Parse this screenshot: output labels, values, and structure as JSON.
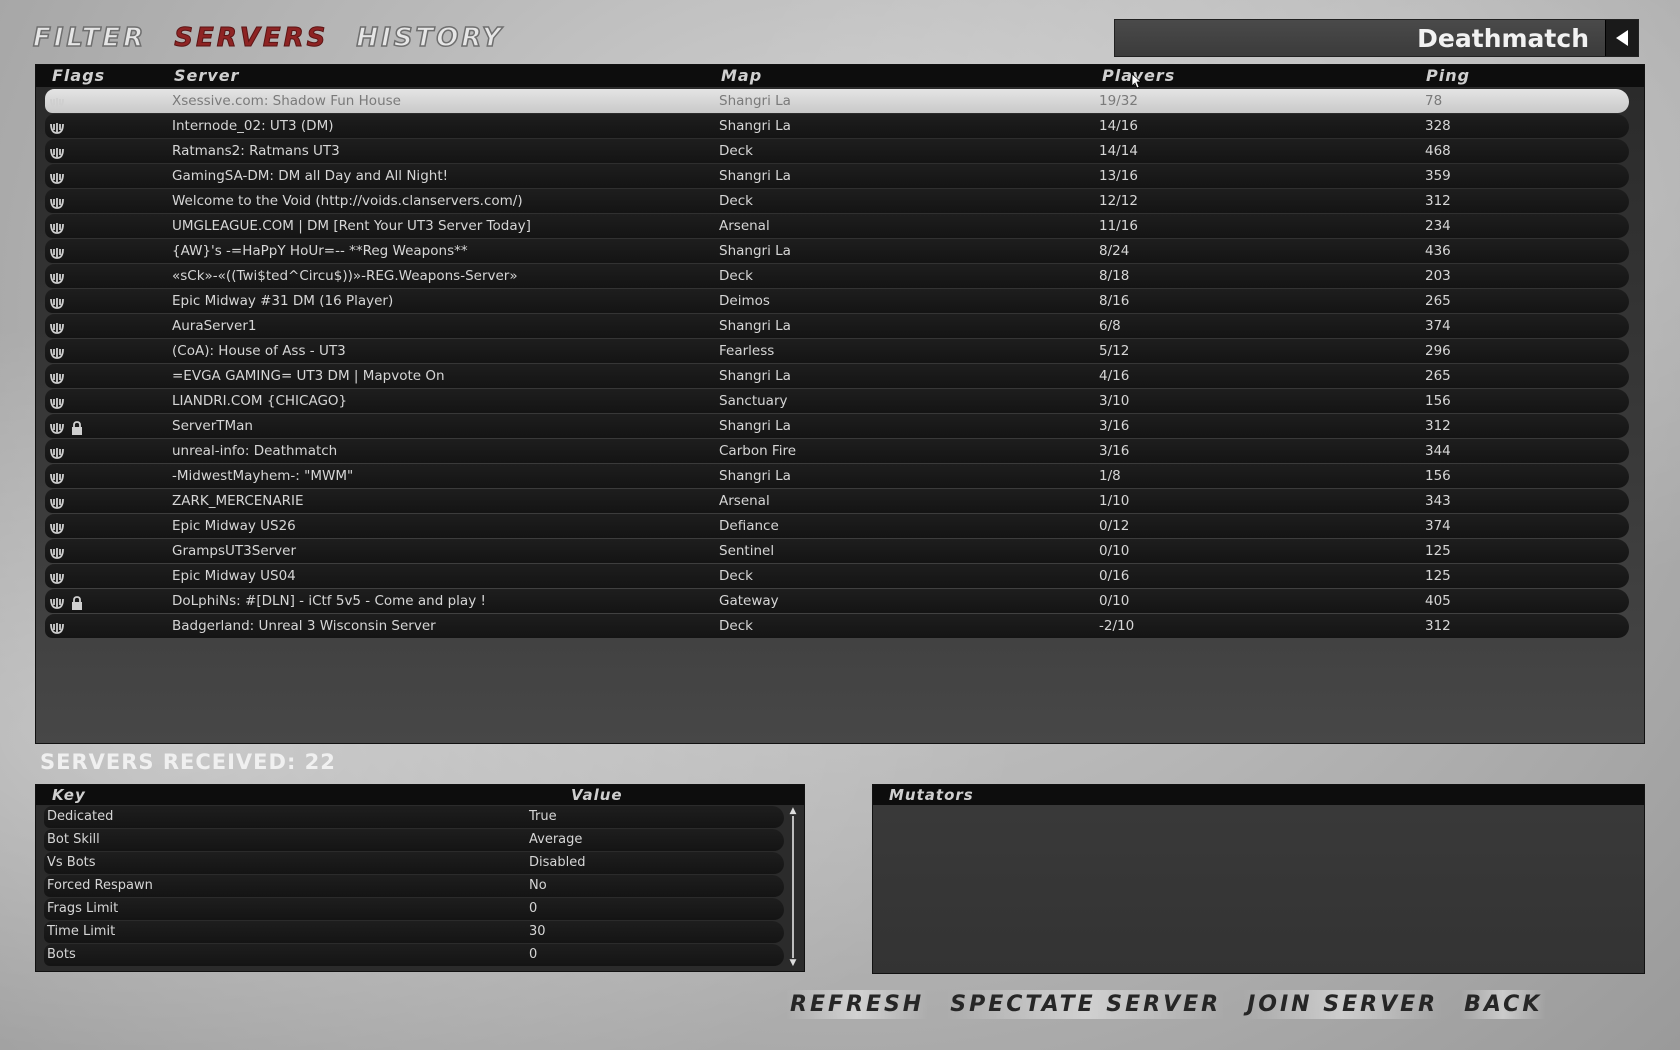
{
  "tabs": [
    {
      "label": "FILTER"
    },
    {
      "label": "SERVERS"
    },
    {
      "label": "HISTORY"
    }
  ],
  "gametype": {
    "label": "Deathmatch"
  },
  "columns": {
    "flags": "Flags",
    "server": "Server",
    "map": "Map",
    "players": "Players",
    "ping": "Ping"
  },
  "servers": [
    {
      "name": "Xsessive.com: Shadow Fun House",
      "map": "Shangri La",
      "players": "19/32",
      "ping": "78",
      "locked": false,
      "selected": true
    },
    {
      "name": "Internode_02: UT3 (DM)",
      "map": "Shangri La",
      "players": "14/16",
      "ping": "328",
      "locked": false
    },
    {
      "name": "Ratmans2: Ratmans UT3",
      "map": "Deck",
      "players": "14/14",
      "ping": "468",
      "locked": false
    },
    {
      "name": "GamingSA-DM: DM all Day and All Night!",
      "map": "Shangri La",
      "players": "13/16",
      "ping": "359",
      "locked": false
    },
    {
      "name": "Welcome to the Void (http://voids.clanservers.com/)",
      "map": "Deck",
      "players": "12/12",
      "ping": "312",
      "locked": false
    },
    {
      "name": "UMGLEAGUE.COM | DM [Rent Your UT3 Server Today]",
      "map": "Arsenal",
      "players": "11/16",
      "ping": "234",
      "locked": false
    },
    {
      "name": "{AW}'s -=HaPpY HoUr=-- **Reg Weapons**",
      "map": "Shangri La",
      "players": "8/24",
      "ping": "436",
      "locked": false
    },
    {
      "name": "«sCk»-«((Twi$ted^Circu$))»-REG.Weapons-Server»",
      "map": "Deck",
      "players": "8/18",
      "ping": "203",
      "locked": false
    },
    {
      "name": "Epic Midway #31 DM (16 Player)",
      "map": "Deimos",
      "players": "8/16",
      "ping": "265",
      "locked": false
    },
    {
      "name": "AuraServer1",
      "map": "Shangri La",
      "players": "6/8",
      "ping": "374",
      "locked": false
    },
    {
      "name": "(CoA): House of Ass - UT3",
      "map": "Fearless",
      "players": "5/12",
      "ping": "296",
      "locked": false
    },
    {
      "name": "=EVGA GAMING= UT3 DM | Mapvote On",
      "map": "Shangri La",
      "players": "4/16",
      "ping": "265",
      "locked": false
    },
    {
      "name": "LIANDRI.COM {CHICAGO}",
      "map": "Sanctuary",
      "players": "3/10",
      "ping": "156",
      "locked": false
    },
    {
      "name": "ServerTMan",
      "map": "Shangri La",
      "players": "3/16",
      "ping": "312",
      "locked": true
    },
    {
      "name": "unreal-info: Deathmatch",
      "map": "Carbon Fire",
      "players": "3/16",
      "ping": "344",
      "locked": false
    },
    {
      "name": "-MidwestMayhem-: \"MWM\"",
      "map": "Shangri La",
      "players": "1/8",
      "ping": "156",
      "locked": false
    },
    {
      "name": "ZARK_MERCENARIE",
      "map": "Arsenal",
      "players": "1/10",
      "ping": "343",
      "locked": false
    },
    {
      "name": "Epic Midway US26",
      "map": "Defiance",
      "players": "0/12",
      "ping": "374",
      "locked": false
    },
    {
      "name": "GrampsUT3Server",
      "map": "Sentinel",
      "players": "0/10",
      "ping": "125",
      "locked": false
    },
    {
      "name": "Epic Midway US04",
      "map": "Deck",
      "players": "0/16",
      "ping": "125",
      "locked": false
    },
    {
      "name": "DoLphiNs: #[DLN] - iCtf 5v5 - Come and play !",
      "map": "Gateway",
      "players": "0/10",
      "ping": "405",
      "locked": true
    },
    {
      "name": "Badgerland: Unreal 3 Wisconsin Server",
      "map": "Deck",
      "players": "-2/10",
      "ping": "312",
      "locked": false
    }
  ],
  "received_label": "SERVERS RECEIVED: 22",
  "details": {
    "key_header": "Key",
    "value_header": "Value",
    "rows": [
      {
        "key": "Dedicated",
        "value": "True"
      },
      {
        "key": "Bot Skill",
        "value": "Average"
      },
      {
        "key": "Vs Bots",
        "value": "Disabled"
      },
      {
        "key": "Forced Respawn",
        "value": "No"
      },
      {
        "key": "Frags Limit",
        "value": "0"
      },
      {
        "key": "Time Limit",
        "value": "30"
      },
      {
        "key": "Bots",
        "value": "0"
      }
    ]
  },
  "mutators": {
    "header": "Mutators"
  },
  "buttons": {
    "refresh": "REFRESH",
    "spectate": "SPECTATE SERVER",
    "join": "JOIN SERVER",
    "back": "BACK"
  },
  "colors": {
    "active_tab": "#8e2424",
    "panel": "#2a2a2a",
    "row": "#1a1a1a",
    "selected_row": "#d9d9d9"
  },
  "icons": {
    "server_type": "ut-logo-icon",
    "password": "lock-icon",
    "gametype_toggle": "triangle-left-icon"
  }
}
